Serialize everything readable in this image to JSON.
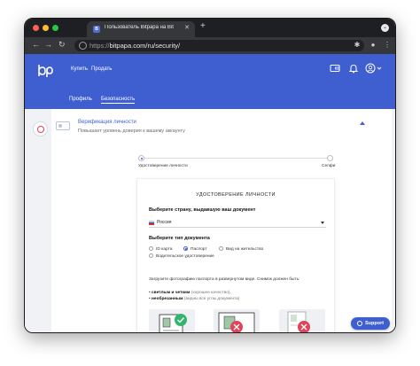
{
  "browser": {
    "tab_title": "Пользователь Bitpapa на Bit",
    "favicon_letter": "B",
    "url_scheme": "https://",
    "url_rest": "bitpapa.com/ru/security/"
  },
  "nav": {
    "buy": "Купить",
    "sell": "Продать",
    "profile_tab": "Профиль",
    "security_tab": "Безопасность"
  },
  "verification": {
    "title": "Верификация личности",
    "subtitle": "Повышает уровень доверия к вашему аккаунту"
  },
  "steps": {
    "step1": "Удостоверение личности",
    "step2": "Селфи"
  },
  "form": {
    "title": "УДОСТОВЕРЕНИЕ ЛИЧНОСТИ",
    "country_label": "Выберите страну, выдавшую ваш документ",
    "country_value": "Россия",
    "doc_type_label": "Выберите тип документа",
    "doc_types": [
      "ID карта",
      "Паспорт",
      "Вид на жительство",
      "Водительское удостоверение"
    ],
    "selected_doc_type": "Паспорт",
    "upload_desc": "Загрузите фотографию паспорта в развернутом виде. Снимок должен быть:",
    "req1_bold": "светлым и четким",
    "req1_note": " (хорошее качество),",
    "req2_bold": "необрезанным",
    "req2_note": " (видны все углы документа)"
  },
  "support": {
    "label": "Support"
  },
  "colors": {
    "brand": "#3f5fd0",
    "ok": "#34b56e",
    "error": "#e0445a"
  }
}
